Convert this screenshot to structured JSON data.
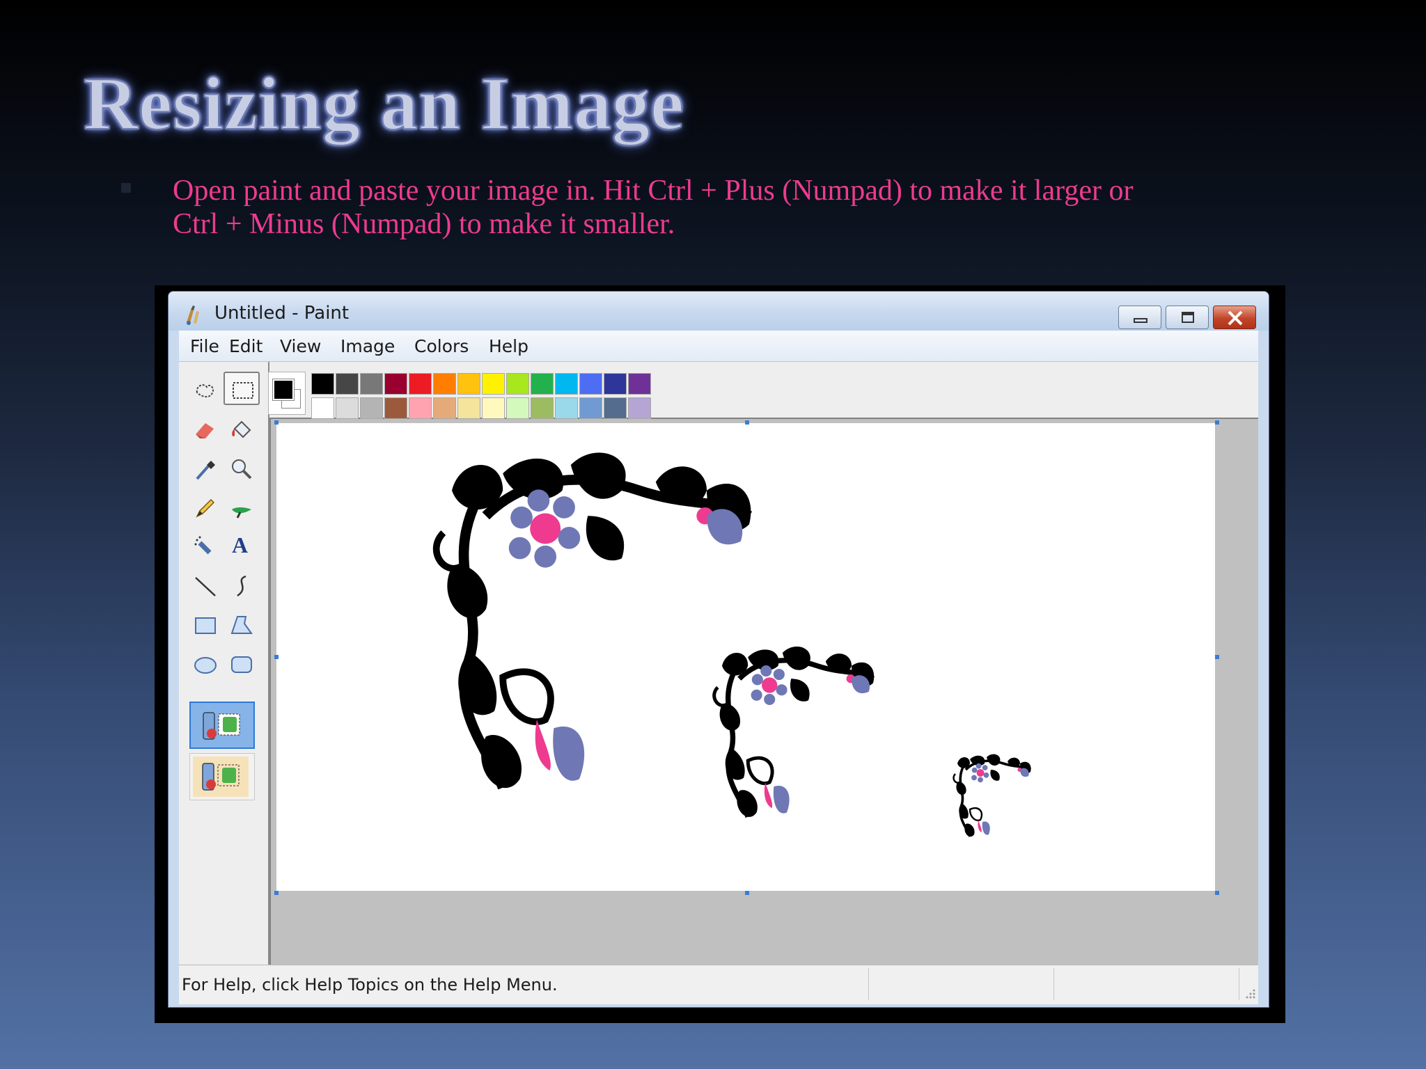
{
  "slide": {
    "title": "Resizing an Image",
    "bullet_line1": "Open paint and paste your image in. Hit Ctrl + Plus (Numpad) to make it larger or",
    "bullet_line2": "Ctrl + Minus (Numpad) to make it smaller."
  },
  "window": {
    "title": "Untitled - Paint",
    "controls": [
      "minimize-icon",
      "maximize-icon",
      "close-icon"
    ]
  },
  "menu": {
    "items": [
      "File",
      "Edit",
      "View",
      "Image",
      "Colors",
      "Help"
    ]
  },
  "toolbox": {
    "tools": [
      "free-form-select-icon",
      "select-icon",
      "eraser-icon",
      "fill-bucket-icon",
      "eyedropper-icon",
      "magnifier-icon",
      "pencil-icon",
      "brush-icon",
      "airbrush-icon",
      "text-icon",
      "line-icon",
      "curve-icon",
      "rectangle-icon",
      "polygon-icon",
      "ellipse-icon",
      "rounded-rectangle-icon"
    ],
    "selected_tool": "select-icon",
    "options": [
      "opaque-selection-icon",
      "transparent-selection-icon"
    ]
  },
  "palette": {
    "primary": "#000000",
    "secondary": "#ffffff",
    "row1": [
      "#000000",
      "#464646",
      "#787878",
      "#990030",
      "#ed1c24",
      "#ff7e00",
      "#ffc20e",
      "#fff200",
      "#a8e61d",
      "#22b14c",
      "#00b7ef",
      "#4d6df3",
      "#2f3699",
      "#6f3198"
    ],
    "row2": [
      "#ffffff",
      "#dcdcdc",
      "#b4b4b4",
      "#9c5a3c",
      "#ffa3b1",
      "#e5aa7a",
      "#f5e49c",
      "#fff9bd",
      "#d3f9bc",
      "#9dbb61",
      "#99d9ea",
      "#709ad1",
      "#546d8e",
      "#b5a5d5"
    ]
  },
  "canvas": {
    "ornament_colors": {
      "ink": "#000000",
      "petal": "#6f78b5",
      "center": "#ee3b8f"
    }
  },
  "statusbar": {
    "help_text": "For Help, click Help Topics on the Help Menu."
  }
}
